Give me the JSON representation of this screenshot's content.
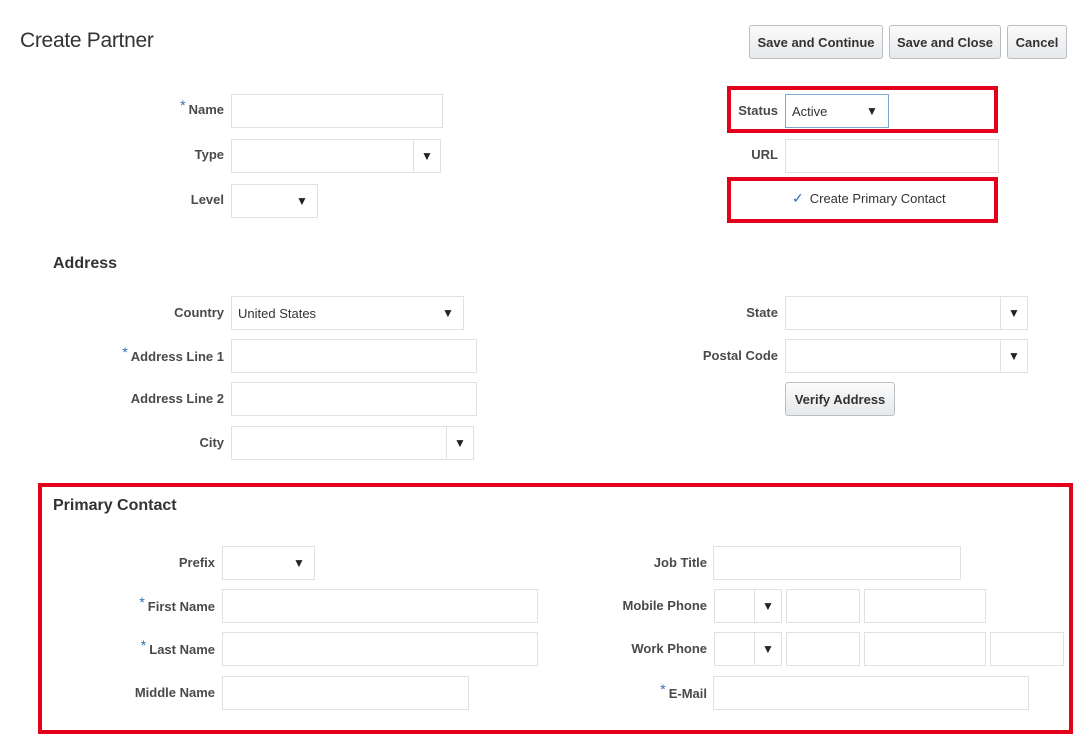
{
  "page": {
    "title": "Create Partner"
  },
  "toolbar": {
    "save_continue": "Save and Continue",
    "save_close": "Save and Close",
    "cancel": "Cancel"
  },
  "partner": {
    "name_label": "Name",
    "type_label": "Type",
    "level_label": "Level",
    "status_label": "Status",
    "status_value": "Active",
    "url_label": "URL",
    "create_primary_contact": "Create Primary Contact"
  },
  "address": {
    "heading": "Address",
    "country_label": "Country",
    "country_value": "United States",
    "address1_label": "Address Line 1",
    "address2_label": "Address Line 2",
    "city_label": "City",
    "state_label": "State",
    "postal_label": "Postal Code",
    "verify_button": "Verify Address"
  },
  "contact": {
    "heading": "Primary Contact",
    "prefix_label": "Prefix",
    "first_name_label": "First Name",
    "last_name_label": "Last Name",
    "middle_name_label": "Middle Name",
    "job_title_label": "Job Title",
    "mobile_phone_label": "Mobile Phone",
    "work_phone_label": "Work Phone",
    "email_label": "E-Mail"
  },
  "icons": {
    "dropdown": "chevron-down-icon",
    "check": "checkmark-icon"
  },
  "colors": {
    "highlight": "#e3001b",
    "required": "#2c6fb6"
  }
}
